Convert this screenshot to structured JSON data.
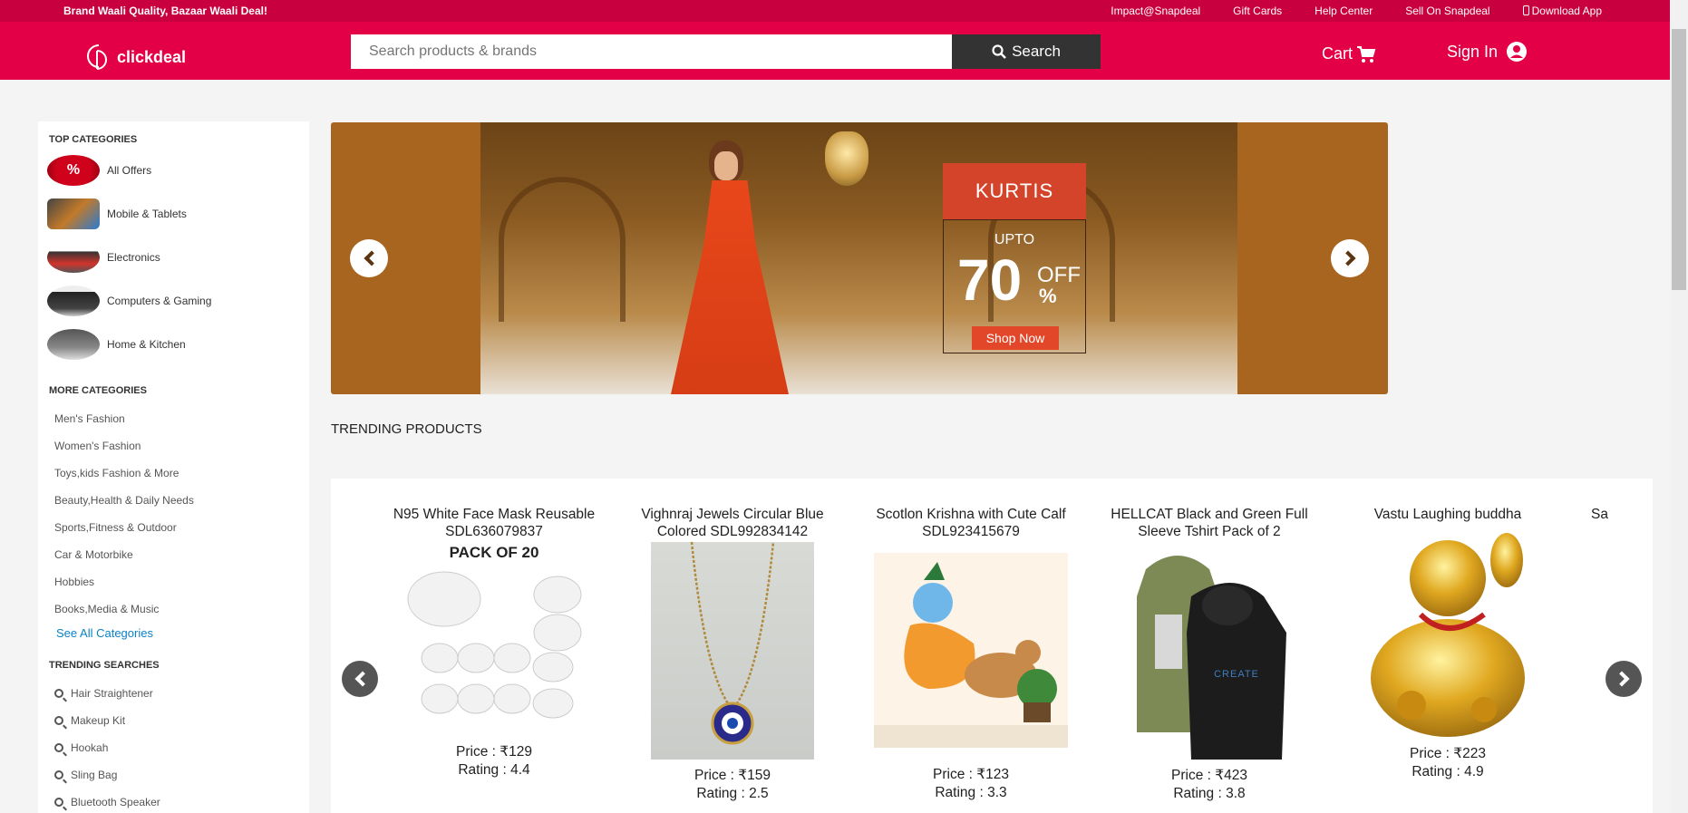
{
  "topbar": {
    "tagline": "Brand Waali Quality, Bazaar Waali Deal!",
    "links": [
      "Impact@Snapdeal",
      "Gift Cards",
      "Help Center",
      "Sell On Snapdeal",
      "Download App"
    ]
  },
  "header": {
    "logo_text": "clickdeal",
    "search_placeholder": "Search products & brands",
    "search_label": "Search",
    "cart_label": "Cart",
    "signin_label": "Sign In"
  },
  "sidebar": {
    "top_title": "TOP CATEGORIES",
    "top_categories": [
      "All Offers",
      "Mobile & Tablets",
      "Electronics",
      "Computers & Gaming",
      "Home & Kitchen"
    ],
    "more_title": "MORE CATEGORIES",
    "more_categories": [
      "Men's Fashion",
      "Women's Fashion",
      "Toys,kids Fashion & More",
      "Beauty,Health & Daily Needs",
      "Sports,Fitness & Outdoor",
      "Car & Motorbike",
      "Hobbies",
      "Books,Media & Music"
    ],
    "see_all": "See All Categories",
    "trending_title": "TRENDING SEARCHES",
    "trending_searches": [
      "Hair Straightener",
      "Makeup Kit",
      "Hookah",
      "Sling Bag",
      "Bluetooth Speaker"
    ]
  },
  "banner": {
    "label": "KURTIS",
    "upto": "UPTO",
    "discount": "70",
    "off": "OFF",
    "percent": "%",
    "cta": "Shop Now"
  },
  "trending": {
    "title": "TRENDING PRODUCTS",
    "products": [
      {
        "name": "N95 White Face Mask Reusable SDL636079837",
        "price": "Price : ₹129",
        "rating": "Rating : 4.4",
        "img_text": "PACK OF 20"
      },
      {
        "name": "Vighnraj Jewels Circular Blue Colored SDL992834142",
        "price": "Price : ₹159",
        "rating": "Rating : 2.5"
      },
      {
        "name": "Scotlon Krishna with Cute Calf SDL923415679",
        "price": "Price : ₹123",
        "rating": "Rating : 3.3"
      },
      {
        "name": "HELLCAT Black and Green Full Sleeve Tshirt Pack of 2",
        "price": "Price : ₹423",
        "rating": "Rating : 3.8",
        "img_text": "CREATE"
      },
      {
        "name": "Vastu Laughing buddha",
        "price": "Price : ₹223",
        "rating": "Rating : 4.9"
      },
      {
        "name": "Sa"
      }
    ]
  }
}
